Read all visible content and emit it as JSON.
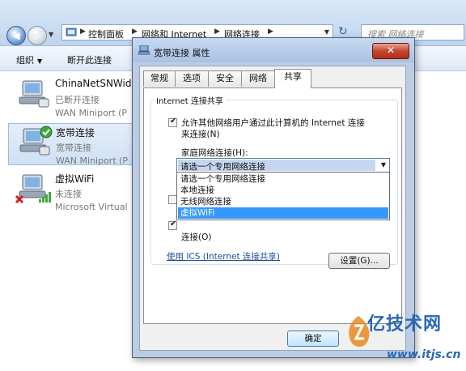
{
  "explorer": {
    "breadcrumbs": [
      "控制面板",
      "网络和 Internet",
      "网络连接"
    ],
    "search_placeholder": "搜索 网络连接",
    "toolbar": {
      "organize": "组织",
      "disconnect": "断开此连接"
    }
  },
  "connections": [
    {
      "name": "ChinaNetSNWide",
      "status": "已断开连接",
      "device": "WAN Miniport (P"
    },
    {
      "name": "宽带连接",
      "status": "宽带连接",
      "device": "WAN Miniport (P"
    },
    {
      "name": "虚拟WiFi",
      "status": "未连接",
      "device": "Microsoft Virtual"
    }
  ],
  "dialog": {
    "title": "宽带连接 属性",
    "close": "✕",
    "tabs": [
      "常规",
      "选项",
      "安全",
      "网络",
      "共享"
    ],
    "active_tab": "共享",
    "group_title": "Internet 连接共享",
    "allow_sharing": {
      "text_line1": "允许其他网络用户通过此计算机的 Internet 连接",
      "text_line2": "来连接(N)",
      "checked": true
    },
    "home_network_label": "家庭网络连接(H):",
    "combo_value": "请选一个专用网络连接",
    "dropdown_options": [
      "请选一个专用网络连接",
      "本地连接",
      "无线网络连接",
      "虚拟WiFi"
    ],
    "highlighted_option": "虚拟WiFi",
    "allow_control": {
      "text_line2": "连接(O)",
      "checked": true
    },
    "ics_link": "使用 ICS (Internet 连接共享)",
    "settings_button": "设置(G)...",
    "ok_button": "确定"
  },
  "watermark": {
    "text": "亿技术网",
    "url": "www.itjs.cn"
  }
}
